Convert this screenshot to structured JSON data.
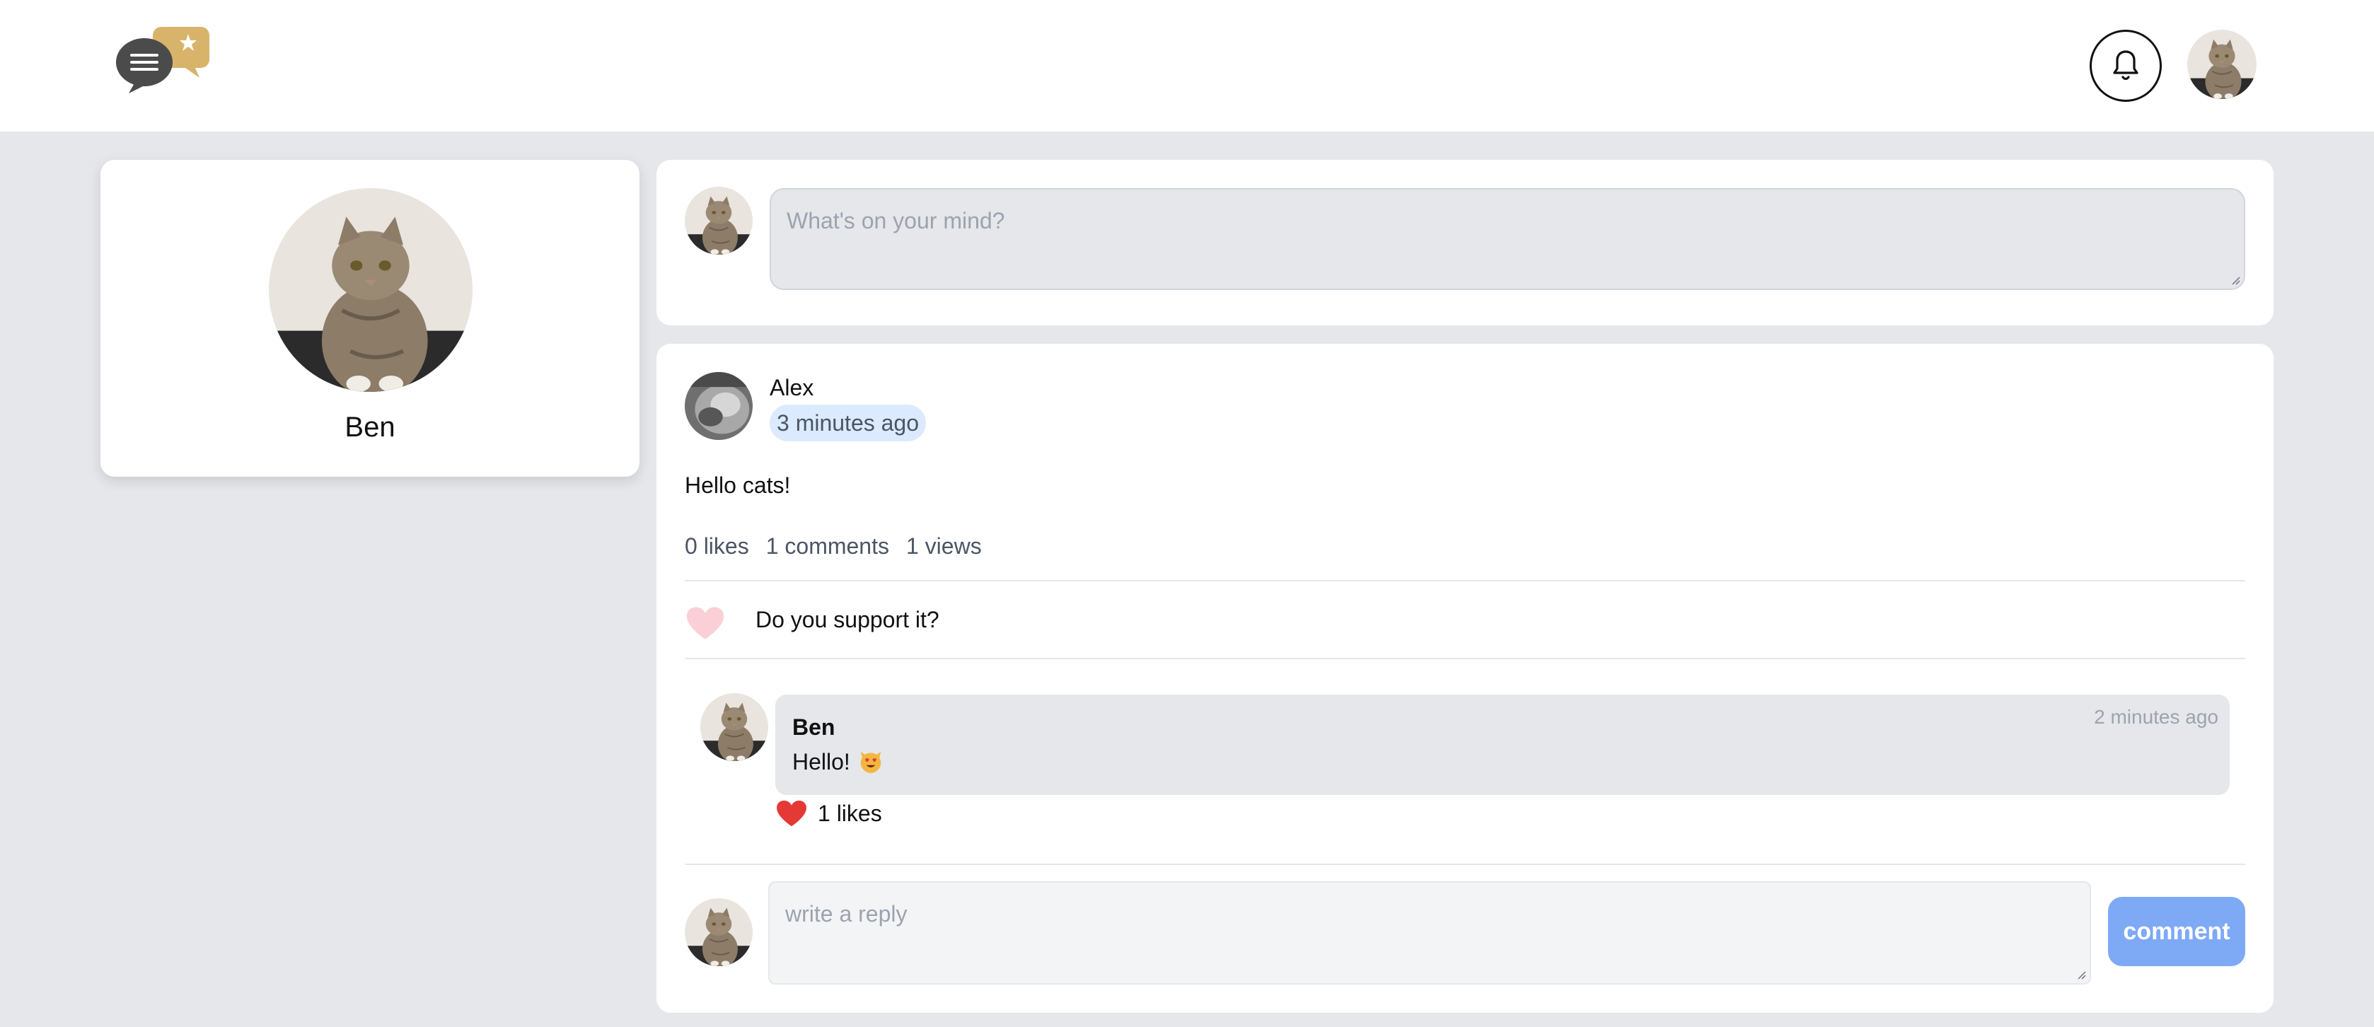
{
  "header": {
    "logo_icon": "chat-bubbles-star-logo",
    "bell_icon": "bell-icon",
    "user_avatar": "cat-avatar"
  },
  "sidebar": {
    "profile_name": "Ben"
  },
  "composer": {
    "placeholder": "What's on your mind?"
  },
  "post": {
    "author": "Alex",
    "time": "3 minutes ago",
    "text": "Hello cats!",
    "stats": {
      "likes": "0 likes",
      "comments": "1 comments",
      "views": "1 views"
    },
    "poll_question": "Do you support it?",
    "comments": [
      {
        "author": "Ben",
        "time": "2 minutes ago",
        "text": "Hello!",
        "likes_label": "1 likes"
      }
    ],
    "reply_placeholder": "write a reply",
    "comment_button": "comment"
  },
  "colors": {
    "page_bg": "#e5e7eb",
    "accent_blue": "#7ea9f5",
    "badge_bg": "#dbeafe",
    "heart_red": "#e53935",
    "heart_light": "#fbcfd6",
    "logo_gold": "#d8b46a",
    "logo_dark": "#4b4b4b"
  }
}
